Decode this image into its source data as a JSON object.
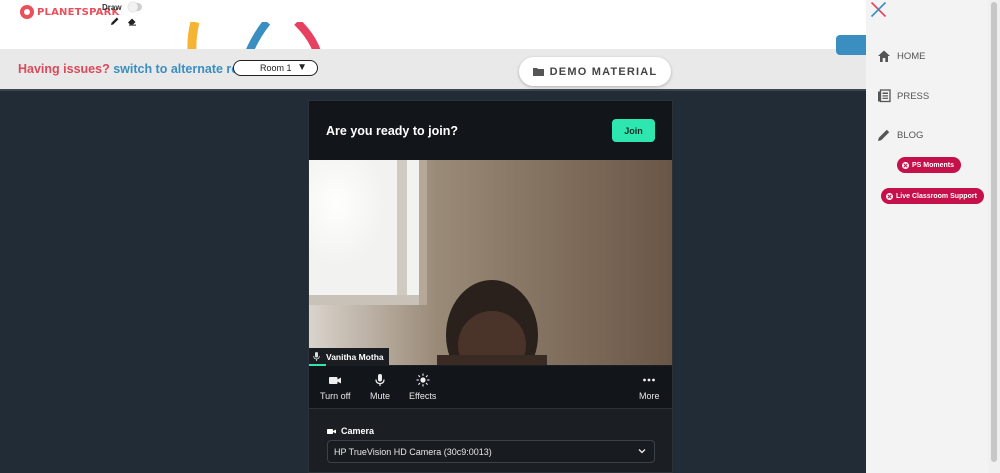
{
  "header": {
    "brand_name": "PLANETSPARK",
    "draw_label": "Draw"
  },
  "issue_bar": {
    "issue_text": "Having issues?",
    "switch_text": "switch to alternate room",
    "room_value": "Room 1",
    "demo_material_label": "DEMO MATERIAL"
  },
  "join_card": {
    "title": "Are you ready to join?",
    "join_label": "Join",
    "participant_name": "Vanitha Motha",
    "controls": {
      "camera_label": "Turn off",
      "mic_label": "Mute",
      "effects_label": "Effects",
      "more_label": "More"
    },
    "camera_section_label": "Camera",
    "camera_device": "HP TrueVision HD Camera (30c9:0013)"
  },
  "sidebar": {
    "items": [
      {
        "label": "HOME",
        "icon": "home-icon"
      },
      {
        "label": "PRESS",
        "icon": "newspaper-icon"
      },
      {
        "label": "BLOG",
        "icon": "pencil-icon"
      }
    ],
    "ps_moments_label": "PS Moments",
    "live_support_label": "Live Classroom Support"
  },
  "colors": {
    "accent_green": "#2ee6b0",
    "brand_red": "#d94a5a",
    "link_blue": "#3a8fc0",
    "pill_red": "#c5104a",
    "stage_bg": "#212c36"
  }
}
